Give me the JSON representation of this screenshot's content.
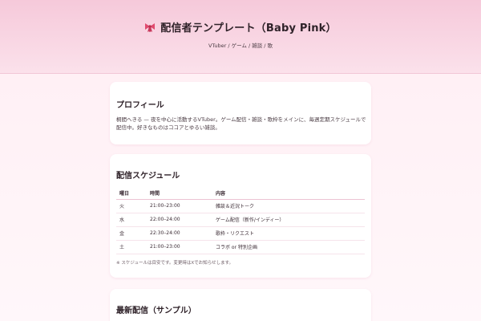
{
  "header": {
    "title": "配信者テンプレート（Baby Pink）",
    "tags": "VTuber / ゲーム / 雑談 / 歌",
    "icon": "ribbon-icon",
    "accent_color": "#e04a6e"
  },
  "profile": {
    "heading": "プロフィール",
    "text": "桐間へきる — 夜を中心に活動するVTuber。ゲーム配信・雑談・歌枠をメインに、毎週定期スケジュールで配信中。好きなものはココアとゆるい雑談。"
  },
  "schedule": {
    "heading": "配信スケジュール",
    "columns": [
      "曜日",
      "時間",
      "内容"
    ],
    "rows": [
      {
        "day": "火",
        "time": "21:00–23:00",
        "content": "雑談＆近況トーク"
      },
      {
        "day": "水",
        "time": "22:00–24:00",
        "content": "ゲーム配信（新作/インディー）"
      },
      {
        "day": "金",
        "time": "22:30–24:00",
        "content": "歌枠・リクエスト"
      },
      {
        "day": "土",
        "time": "21:00–23:00",
        "content": "コラボ or 特別企画"
      }
    ],
    "note": "※ スケジュールは目安です。変更時はXでお知らせします。"
  },
  "recent": {
    "heading": "最新配信（サンプル）"
  }
}
